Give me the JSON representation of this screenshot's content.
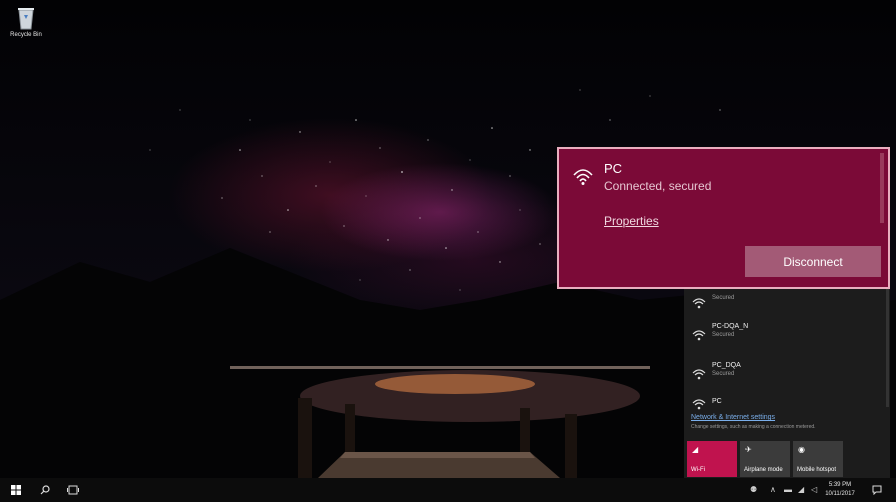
{
  "desktop": {
    "recycle_bin_label": "Recycle Bin"
  },
  "connected_card": {
    "network_name": "PC",
    "status": "Connected, secured",
    "properties_link": "Properties",
    "disconnect_button": "Disconnect",
    "background_color": "#7b0a37",
    "icon": "wifi-icon"
  },
  "network_list": [
    {
      "name": "",
      "status": "Secured",
      "icon": "wifi-icon"
    },
    {
      "name": "PC-DQA_N",
      "status": "Secured",
      "icon": "wifi-icon"
    },
    {
      "name": "PC_DQA",
      "status": "Secured",
      "icon": "wifi-icon"
    },
    {
      "name": "PC",
      "status": "",
      "icon": "wifi-icon"
    }
  ],
  "settings": {
    "link": "Network & Internet settings",
    "description": "Change settings, such as making a connection metered."
  },
  "quick_actions": [
    {
      "label": "Wi-Fi",
      "icon": "wifi-icon",
      "active": true
    },
    {
      "label": "Airplane mode",
      "icon": "airplane-icon",
      "active": false
    },
    {
      "label": "Mobile hotspot",
      "icon": "hotspot-icon",
      "active": false
    }
  ],
  "taskbar": {
    "time": "5:39 PM",
    "date": "10/11/2017",
    "accent_color": "#c0134e"
  }
}
